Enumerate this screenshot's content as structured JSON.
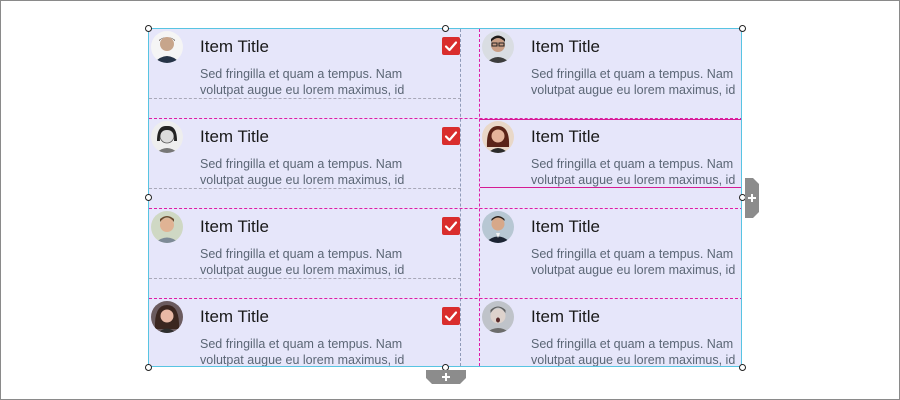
{
  "list_view": {
    "items": [
      {
        "title": "Item Title",
        "desc_line1": "Sed fringilla et quam a tempus. Nam",
        "desc_line2": "volutpat augue eu lorem maximus, id",
        "checked": true,
        "avatar": "man-portrait-avatar"
      },
      {
        "title": "Item Title",
        "desc_line1": "Sed fringilla et quam a tempus. Nam",
        "desc_line2": "volutpat augue eu lorem maximus, id",
        "checked": false,
        "avatar": "man-glasses-avatar"
      },
      {
        "title": "Item Title",
        "desc_line1": "Sed fringilla et quam a tempus. Nam",
        "desc_line2": "volutpat augue eu lorem maximus, id",
        "checked": true,
        "avatar": "woman-sketch-avatar"
      },
      {
        "title": "Item Title",
        "desc_line1": "Sed fringilla et quam a tempus. Nam",
        "desc_line2": "volutpat augue eu lorem maximus, id",
        "checked": false,
        "avatar": "woman-redhair-avatar"
      },
      {
        "title": "Item Title",
        "desc_line1": "Sed fringilla et quam a tempus. Nam",
        "desc_line2": "volutpat augue eu lorem maximus, id",
        "checked": true,
        "avatar": "young-man-avatar"
      },
      {
        "title": "Item Title",
        "desc_line1": "Sed fringilla et quam a tempus. Nam",
        "desc_line2": "volutpat augue eu lorem maximus, id",
        "checked": false,
        "avatar": "man-suit-avatar"
      },
      {
        "title": "Item Title",
        "desc_line1": "Sed fringilla et quam a tempus. Nam",
        "desc_line2": "volutpat augue eu lorem maximus, id",
        "checked": true,
        "avatar": "woman-curly-avatar"
      },
      {
        "title": "Item Title",
        "desc_line1": "Sed fringilla et quam a tempus. Nam",
        "desc_line2": "volutpat augue eu lorem maximus, id",
        "checked": false,
        "avatar": "man-surprised-avatar"
      }
    ]
  },
  "colors": {
    "list_background": "#e6e6fa",
    "selection_border": "#58c4e2",
    "guide_magenta": "#e01aa7",
    "checkbox_red": "#d92d2d",
    "expander_gray": "#8c8c8c"
  },
  "icons": {
    "checkbox": "checkmark-icon",
    "expand_right": "plus-icon",
    "expand_bottom": "plus-icon"
  }
}
